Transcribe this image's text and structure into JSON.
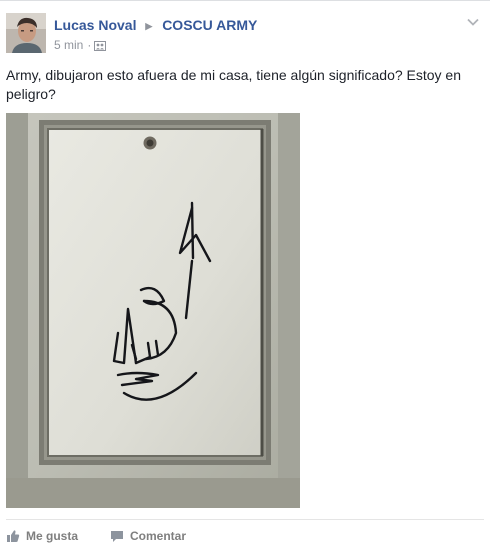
{
  "post": {
    "author": "Lucas Noval",
    "group": "COSCU ARMY",
    "timestamp": "5 min",
    "separator": "·",
    "audience_icon": "group-audience-icon",
    "text": "Army, dibujaron esto afuera de mi casa, tiene algún significado? Estoy en peligro?"
  },
  "actions": {
    "like_label": "Me gusta",
    "comment_label": "Comentar"
  },
  "colors": {
    "link": "#365899",
    "meta": "#90949c",
    "text": "#1d2129",
    "action": "#7f7f7f"
  }
}
